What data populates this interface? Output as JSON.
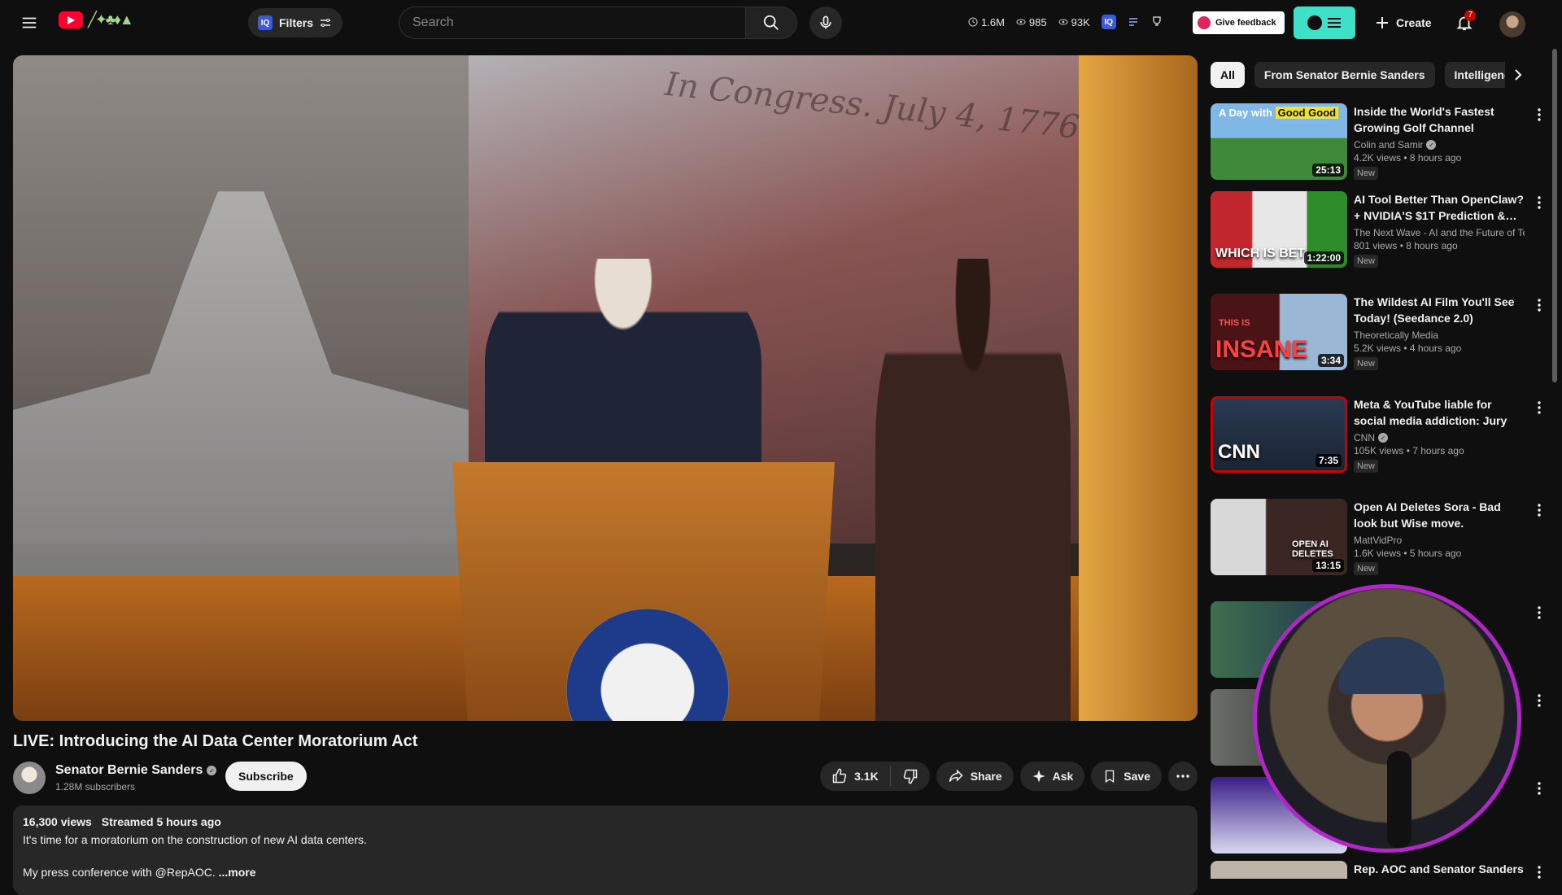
{
  "header": {
    "filters_label": "Filters",
    "search_placeholder": "Search",
    "stats": [
      {
        "icon": "clock-icon",
        "value": "1.6M"
      },
      {
        "icon": "eye-icon",
        "value": "985"
      },
      {
        "icon": "eye-icon",
        "value": "93K"
      }
    ],
    "feedback_label": "Give feedback",
    "create_label": "Create",
    "notification_count": "7"
  },
  "video": {
    "title": "LIVE: Introducing the AI Data Center Moratorium Act",
    "channel_name": "Senator Bernie Sanders",
    "subscribers": "1.28M subscribers",
    "subscribe_label": "Subscribe",
    "likes": "3.1K",
    "share_label": "Share",
    "ask_label": "Ask",
    "save_label": "Save"
  },
  "description": {
    "views": "16,300 views",
    "streamed": "Streamed 5 hours ago",
    "line1": "It's time for a moratorium on the construction of new AI data centers.",
    "line2": "My press conference with @RepAOC.",
    "more_label": "...more"
  },
  "chips": [
    {
      "label": "All",
      "active": true
    },
    {
      "label": "From Senator Bernie Sanders",
      "active": false
    },
    {
      "label": "Intelligence",
      "active": false
    }
  ],
  "recommendations": [
    {
      "title": "Inside the World's Fastest Growing Golf Channel",
      "channel": "Colin and Samir",
      "verified": true,
      "meta": "4.2K views • 8 hours ago",
      "badge": "New",
      "duration": "25:13",
      "thumb_text": "A Day with",
      "thumb_highlight": "Good Good"
    },
    {
      "title": "AI Tool Better Than OpenClaw? + NVIDIA'S $1T Prediction & AI...",
      "channel": "The Next Wave - AI and the Future of Tec...",
      "verified": false,
      "meta": "801 views • 8 hours ago",
      "badge": "New",
      "duration": "1:22:00",
      "thumb_text": "WHICH IS BET"
    },
    {
      "title": "The Wildest AI Film You'll See Today! (Seedance 2.0)",
      "channel": "Theoretically Media",
      "verified": false,
      "meta": "5.2K views • 4 hours ago",
      "badge": "New",
      "duration": "3:34",
      "thumb_text": "INSANE",
      "thumb_highlight": "THIS IS"
    },
    {
      "title": "Meta & YouTube liable for social media addiction: Jury",
      "channel": "CNN",
      "verified": true,
      "meta": "105K views • 7 hours ago",
      "badge": "New",
      "duration": "7:35",
      "thumb_text": "CNN"
    },
    {
      "title": "Open AI Deletes Sora - Bad look but Wise move.",
      "channel": "MattVidPro",
      "verified": false,
      "meta": "1.6K views • 5 hours ago",
      "badge": "New",
      "duration": "13:15",
      "thumb_text": "OPEN AI DELETES"
    },
    {
      "title": "Rep. AOC and Senator Sanders",
      "channel": "",
      "verified": false,
      "meta": "",
      "badge": "",
      "duration": "",
      "thumb_text": ""
    }
  ],
  "colors": {
    "background": "#0f0f0f",
    "surface": "#272727",
    "accent_red": "#ff0033",
    "pip_ring": "#b026c7",
    "teal": "#3ee0c8"
  }
}
